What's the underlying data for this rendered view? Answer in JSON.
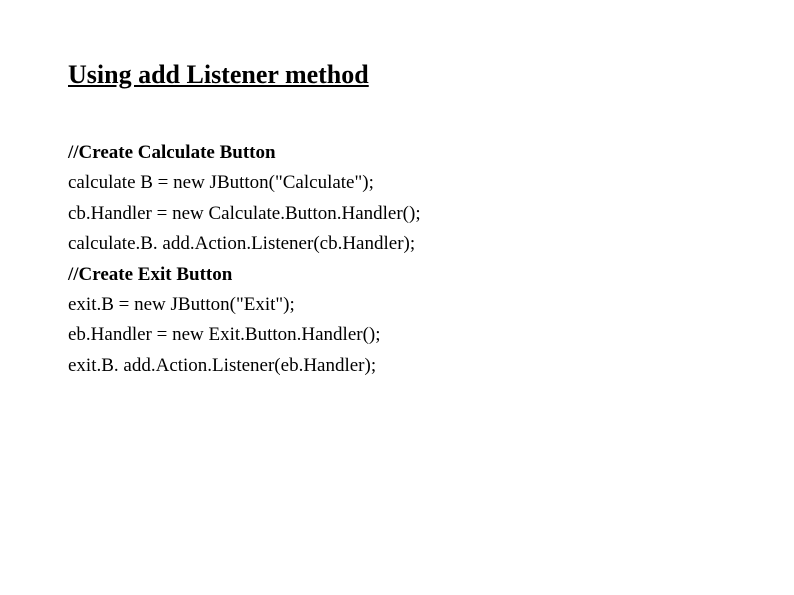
{
  "title": "Using add Listener method",
  "lines": {
    "l0": "//Create Calculate Button",
    "l1": "calculate B = new JButton(\"Calculate\");",
    "l2": "cb.Handler = new Calculate.Button.Handler();",
    "l3": "calculate.B. add.Action.Listener(cb.Handler);",
    "l4": "//Create Exit Button",
    "l5": "exit.B = new JButton(\"Exit\");",
    "l6": "eb.Handler = new Exit.Button.Handler();",
    "l7": "exit.B. add.Action.Listener(eb.Handler);"
  }
}
